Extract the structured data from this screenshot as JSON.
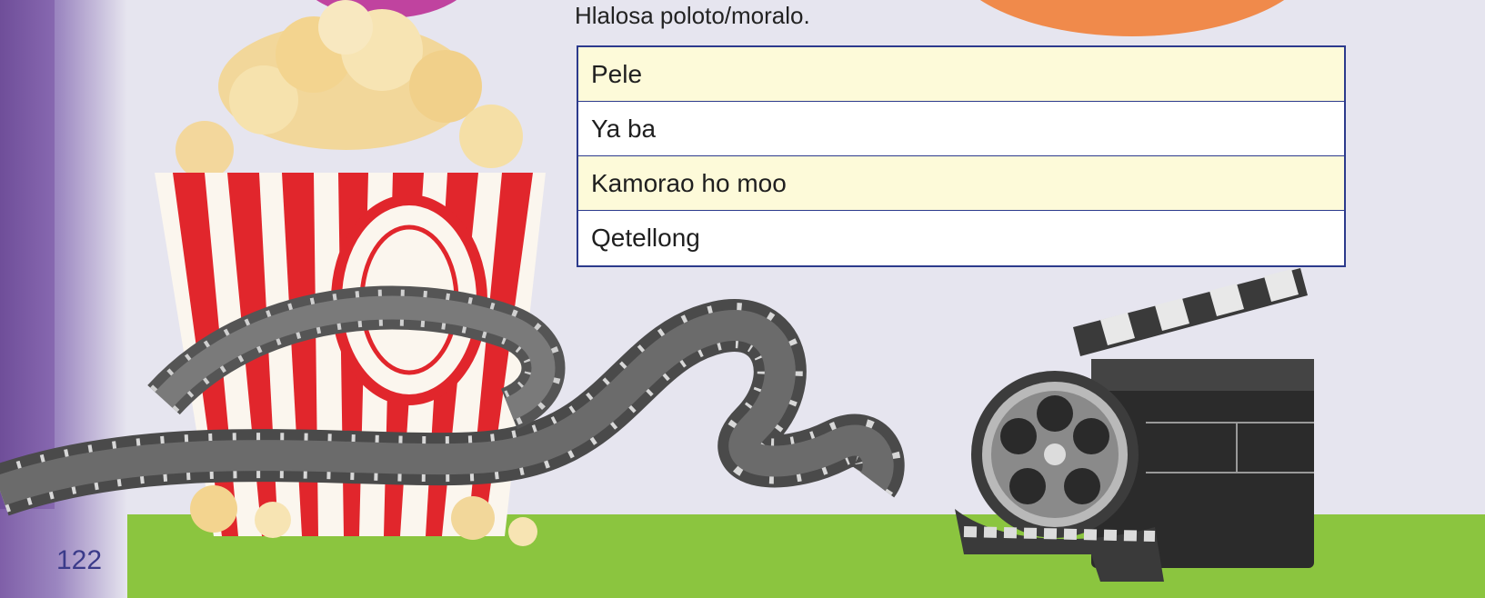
{
  "page": {
    "instruction": "Hlalosa poloto/moralo.",
    "page_number": "122"
  },
  "table": {
    "rows": [
      "Pele",
      "Ya ba",
      "Kamorao ho moo",
      "Qetellong"
    ]
  },
  "colors": {
    "table_border": "#2c3a8c",
    "row_tint": "#fdfad9",
    "grass": "#8bc53f",
    "background": "#e6e5ef",
    "purple_band": "#7f5fa8",
    "pink_bubble": "#c0439f",
    "orange_bubble": "#f08a4b"
  }
}
